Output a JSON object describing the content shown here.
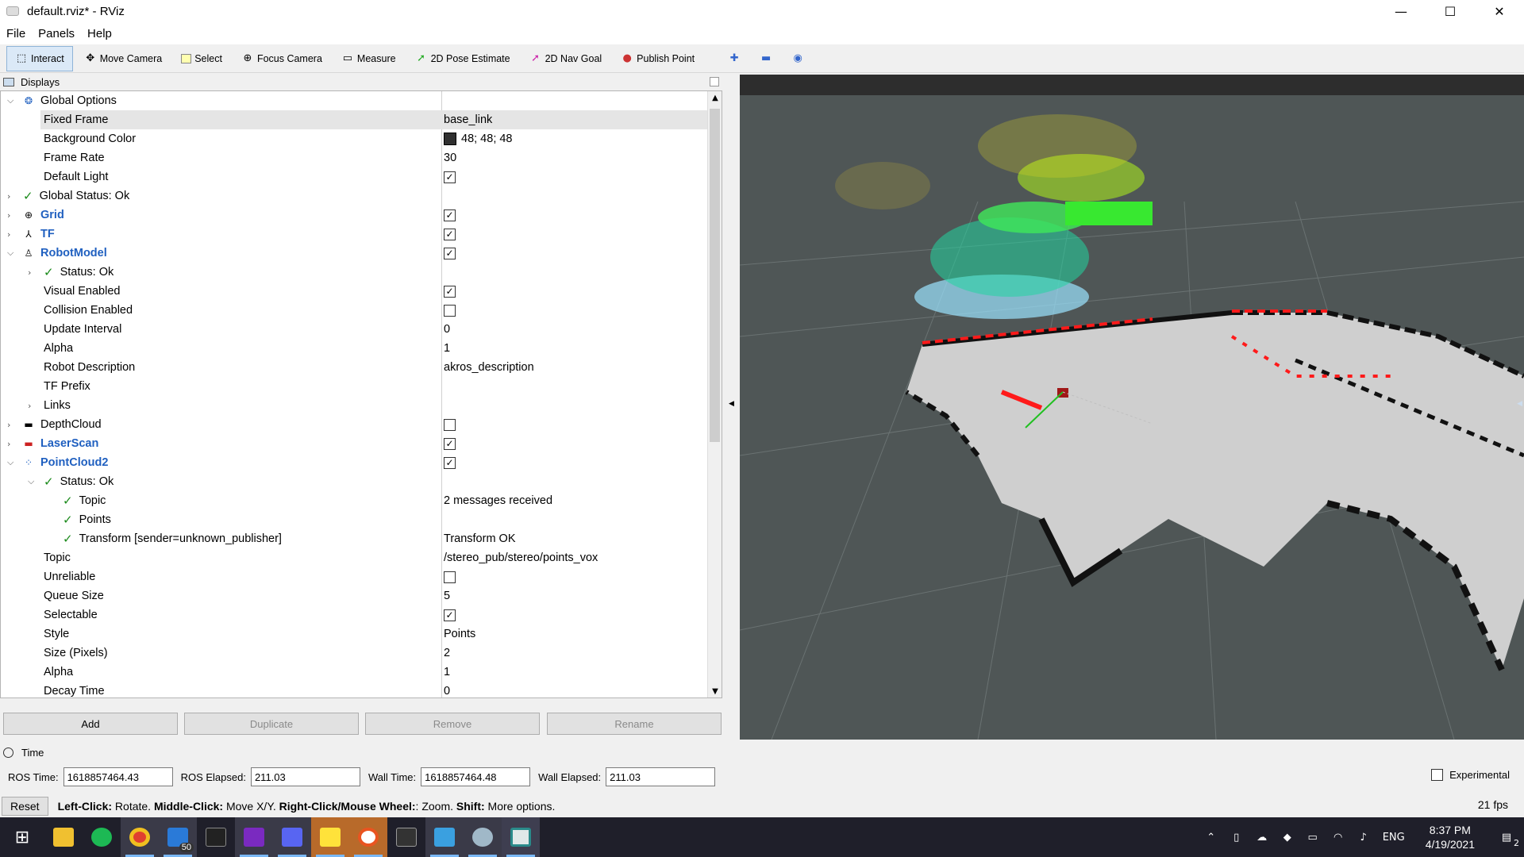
{
  "window": {
    "title": "default.rviz* - RViz",
    "minimize": "—",
    "maximize": "☐",
    "close": "✕"
  },
  "menu": [
    "File",
    "Panels",
    "Help"
  ],
  "toolbar": {
    "tools": [
      {
        "label": "Interact",
        "icon": "cursor-icon"
      },
      {
        "label": "Move Camera",
        "icon": "move-icon"
      },
      {
        "label": "Select",
        "icon": "select-icon"
      },
      {
        "label": "Focus Camera",
        "icon": "focus-icon"
      },
      {
        "label": "Measure",
        "icon": "ruler-icon"
      },
      {
        "label": "2D Pose Estimate",
        "icon": "pose-arrow-icon"
      },
      {
        "label": "2D Nav Goal",
        "icon": "goal-arrow-icon"
      },
      {
        "label": "Publish Point",
        "icon": "pin-icon"
      }
    ]
  },
  "displays": {
    "title": "Displays",
    "rows": [
      {
        "label": "Global Options",
        "value": ""
      },
      {
        "label": "Fixed Frame",
        "value": "base_link"
      },
      {
        "label": "Background Color",
        "value": "48; 48; 48"
      },
      {
        "label": "Frame Rate",
        "value": "30"
      },
      {
        "label": "Default Light",
        "value": ""
      },
      {
        "label": "Global Status: Ok",
        "value": ""
      },
      {
        "label": "Grid",
        "value": ""
      },
      {
        "label": "TF",
        "value": ""
      },
      {
        "label": "RobotModel",
        "value": ""
      },
      {
        "label": "Status: Ok",
        "value": ""
      },
      {
        "label": "Visual Enabled",
        "value": ""
      },
      {
        "label": "Collision Enabled",
        "value": ""
      },
      {
        "label": "Update Interval",
        "value": "0"
      },
      {
        "label": "Alpha",
        "value": "1"
      },
      {
        "label": "Robot Description",
        "value": "akros_description"
      },
      {
        "label": "TF Prefix",
        "value": ""
      },
      {
        "label": "Links",
        "value": ""
      },
      {
        "label": "DepthCloud",
        "value": ""
      },
      {
        "label": "LaserScan",
        "value": ""
      },
      {
        "label": "PointCloud2",
        "value": ""
      },
      {
        "label": "Status: Ok",
        "value": ""
      },
      {
        "label": "Topic",
        "value": "2 messages received"
      },
      {
        "label": "Points",
        "value": ""
      },
      {
        "label": "Transform [sender=unknown_publisher]",
        "value": "Transform OK"
      },
      {
        "label": "Topic",
        "value": "/stereo_pub/stereo/points_vox"
      },
      {
        "label": "Unreliable",
        "value": ""
      },
      {
        "label": "Queue Size",
        "value": "5"
      },
      {
        "label": "Selectable",
        "value": ""
      },
      {
        "label": "Style",
        "value": "Points"
      },
      {
        "label": "Size (Pixels)",
        "value": "2"
      },
      {
        "label": "Alpha",
        "value": "1"
      },
      {
        "label": "Decay Time",
        "value": "0"
      }
    ],
    "checkboxes": {
      "default_light": true,
      "grid": true,
      "tf": true,
      "robotmodel": true,
      "visual_enabled": true,
      "collision_enabled": false,
      "depthcloud": false,
      "laserscan": true,
      "pointcloud2": true,
      "unreliable": false,
      "selectable": true
    },
    "buttons": {
      "add": "Add",
      "duplicate": "Duplicate",
      "remove": "Remove",
      "rename": "Rename"
    }
  },
  "time": {
    "title": "Time",
    "ros_time_label": "ROS Time:",
    "ros_time": "1618857464.43",
    "ros_elapsed_label": "ROS Elapsed:",
    "ros_elapsed": "211.03",
    "wall_time_label": "Wall Time:",
    "wall_time": "1618857464.48",
    "wall_elapsed_label": "Wall Elapsed:",
    "wall_elapsed": "211.03",
    "experimental": "Experimental"
  },
  "status": {
    "reset": "Reset",
    "b1": "Left-Click:",
    "t1": " Rotate. ",
    "b2": "Middle-Click:",
    "t2": " Move X/Y. ",
    "b3": "Right-Click/Mouse Wheel:",
    "t3": ": Zoom. ",
    "b4": "Shift:",
    "t4": " More options.",
    "fps": "21 fps"
  },
  "taskbar": {
    "apps": [
      "start-icon",
      "explorer-icon",
      "spotify-icon",
      "chrome-icon",
      "mail-icon",
      "terminal-icon",
      "onenote-icon",
      "discord-icon",
      "sticky-notes-icon",
      "ubuntu-icon",
      "epic-games-icon",
      "photos-icon",
      "rviz-icon",
      "app-icon"
    ],
    "mail_badge": "50",
    "lang": "ENG",
    "time": "8:37 PM",
    "date": "4/19/2021",
    "notif": "2"
  },
  "colors": {
    "viewport_bg": "#4f5656",
    "accent": "#2060c0",
    "ok_green": "#1a8a1a"
  }
}
